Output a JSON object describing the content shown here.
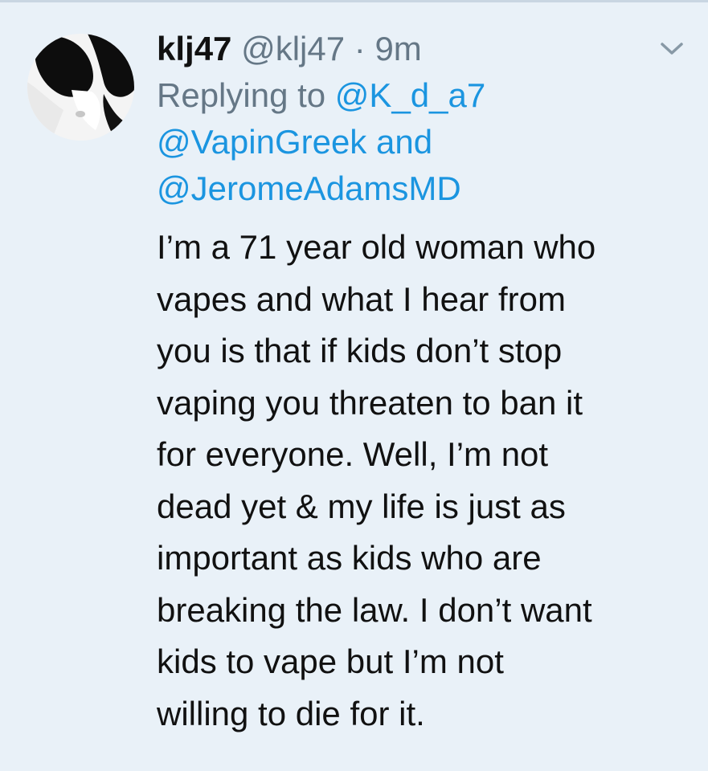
{
  "tweet": {
    "display_name": "klj47",
    "handle": "@klj47",
    "separator": "·",
    "time": "9m",
    "replying_to_label": "Replying to",
    "mentions": [
      "@K_d_a7",
      "@VapinGreek",
      "@JeromeAdamsMD"
    ],
    "and_word": "and",
    "body_lines": [
      "I’m a 71 year old woman who",
      "vapes and what I hear from",
      "you is that if kids don’t stop",
      "vaping you threaten to ban it",
      "for everyone.  Well, I’m not",
      "dead yet & my life is just as",
      "important as kids who are",
      "breaking the law. I don’t want",
      "kids to vape but I’m not",
      "willing to die for it."
    ]
  },
  "icons": {
    "avatar": "cat-avatar",
    "menu": "chevron-down-icon"
  },
  "colors": {
    "background": "#e9f1f8",
    "text": "#111111",
    "muted": "#657786",
    "link": "#1b95e0"
  }
}
